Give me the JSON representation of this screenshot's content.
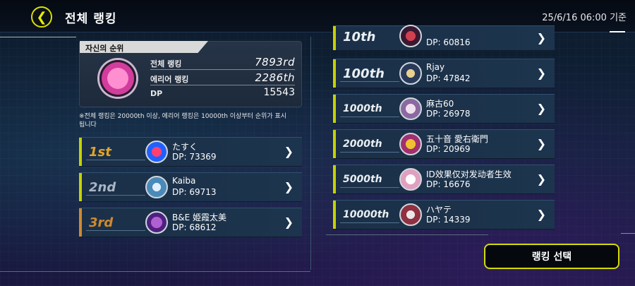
{
  "header": {
    "title": "전체 랭킹",
    "datetime": "25/6/16 06:00 기준"
  },
  "self_rank": {
    "tab_label": "자신의 순위",
    "overall_label": "전체 랭킹",
    "overall_value": "7893rd",
    "area_label": "에리어 랭킹",
    "area_value": "2286th",
    "dp_label": "DP",
    "dp_value": "15543"
  },
  "note": "※전체 랭킹은 20000th 이상, 에리어 랭킹은 10000th 이상부터 순위가 표시됩니다",
  "top_ranks": [
    {
      "rank": "1st",
      "name": "たすく",
      "dp": "DP: 73369"
    },
    {
      "rank": "2nd",
      "name": "Kaiba",
      "dp": "DP: 69713"
    },
    {
      "rank": "3rd",
      "name": "B&E 姫霞太美",
      "dp": "DP: 68612"
    }
  ],
  "milestone_ranks": [
    {
      "rank": "10th",
      "name": "",
      "dp": "DP: 60816"
    },
    {
      "rank": "100th",
      "name": "Rjay",
      "dp": "DP: 47842"
    },
    {
      "rank": "1000th",
      "name": "麻古60",
      "dp": "DP: 26978"
    },
    {
      "rank": "2000th",
      "name": "五十音 愛右衛門",
      "dp": "DP: 20969"
    },
    {
      "rank": "5000th",
      "name": "ID效果仅对发动者生效",
      "dp": "DP: 16676"
    },
    {
      "rank": "10000th",
      "name": "ハヤテ",
      "dp": "DP: 14339"
    }
  ],
  "select_button": "랭킹 선택",
  "colors": {
    "accent": "#d3dc00",
    "gold": "#e3a52a",
    "silver": "#a8b6c6",
    "bronze": "#d08a2e"
  },
  "icons": {
    "back": "chevron-left-icon",
    "row": "chevron-right-icon"
  }
}
